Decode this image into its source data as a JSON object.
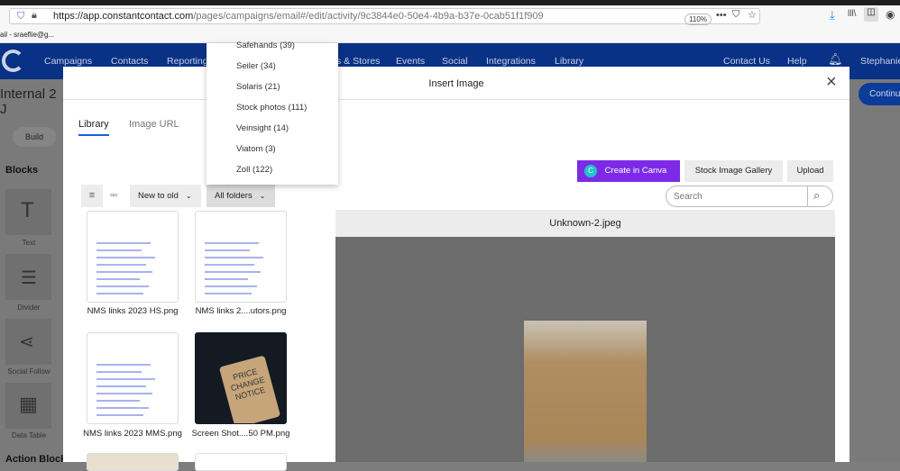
{
  "browser": {
    "url_domain": "https://app.constantcontact.com",
    "url_path": "/pages/campaigns/email#/edit/activity/9c3844e0-50e4-4b9a-b37e-0cab51f1f909",
    "zoom": "110%",
    "bookmark": "ail - sraeflie@g..."
  },
  "nav": {
    "items": [
      "Campaigns",
      "Contacts",
      "Reporting",
      "s & Stores",
      "Events",
      "Social",
      "Integrations",
      "Library"
    ],
    "right": [
      "Contact Us",
      "Help"
    ],
    "user": "Stephanie"
  },
  "page": {
    "title": "Internal 2 J",
    "build": "Build",
    "blocks": "Blocks",
    "block_items": [
      "Text",
      "Divider",
      "Social Follow",
      "Data Table"
    ],
    "action_blocks": "Action Block",
    "continue": "Continu"
  },
  "modal": {
    "title": "Insert Image",
    "tabs": [
      "Library",
      "Image URL"
    ],
    "canva": "Create in Canva",
    "stock": "Stock Image Gallery",
    "upload": "Upload",
    "search_placeholder": "Search",
    "sort": "New to old",
    "folders": "All folders",
    "preview_title": "Unknown-2.jpeg",
    "images": [
      "NMS links 2023 HS.png",
      "NMS links 2....utors.png",
      "NMS links 2023 MMS.png",
      "Screen Shot....50 PM.png"
    ],
    "price_tag": [
      "PRICE",
      "CHANGE",
      "NOTICE"
    ]
  },
  "dropdown": {
    "items": [
      "Safehands (39)",
      "Seiler (34)",
      "Solaris (21)",
      "Stock photos (111)",
      "Veinsight (14)",
      "Viatom (3)",
      "Zoll (122)"
    ]
  },
  "colors": {
    "nav": "#093186",
    "canva": "#7d2ae8",
    "tab_underline": "#1a5fe0"
  }
}
